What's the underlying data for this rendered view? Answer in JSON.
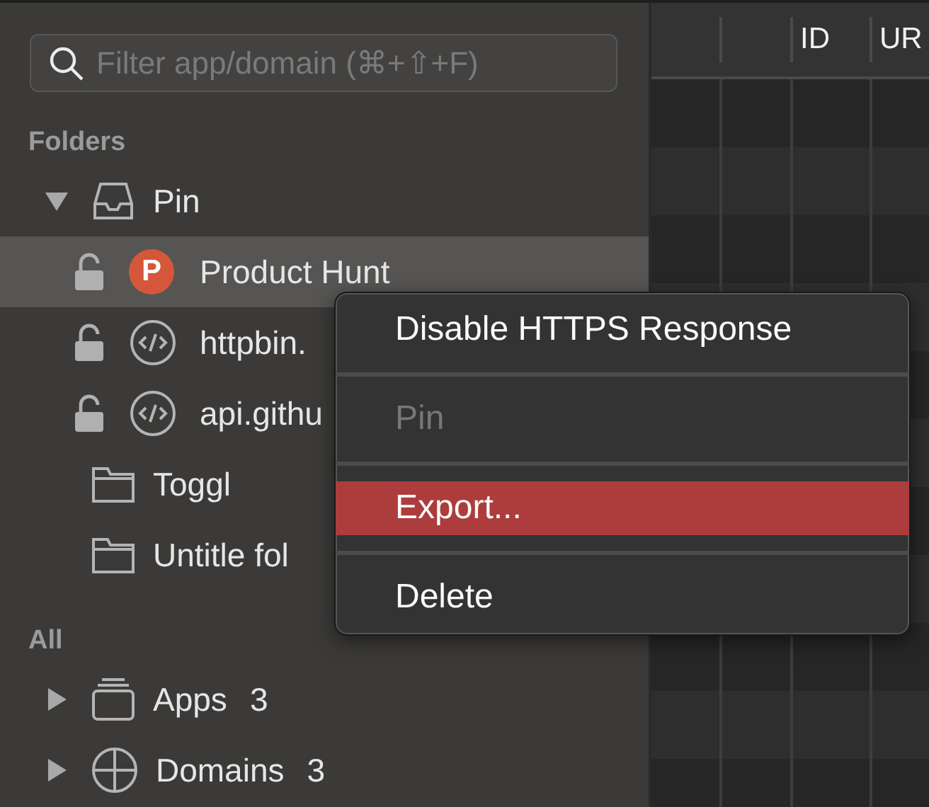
{
  "search": {
    "placeholder": "Filter app/domain (⌘+⇧+F)"
  },
  "sections": [
    {
      "title": "Folders",
      "items": [
        {
          "label": "Pin",
          "kind": "inbox",
          "expanded": true,
          "selected": false,
          "children": [
            {
              "label": "Product Hunt",
              "kind": "logo",
              "badge": "P",
              "selected": true
            },
            {
              "label": "httpbin.",
              "kind": "code",
              "selected": false
            },
            {
              "label": "api.githu",
              "kind": "code",
              "selected": false
            }
          ]
        },
        {
          "label": "Toggl",
          "kind": "folder",
          "selected": false
        },
        {
          "label": "Untitle fol",
          "kind": "folder",
          "selected": false
        }
      ]
    },
    {
      "title": "All",
      "items": [
        {
          "label": "Apps",
          "count": "3",
          "kind": "stack",
          "expanded": false,
          "selected": false
        },
        {
          "label": "Domains",
          "count": "3",
          "kind": "globe",
          "expanded": false,
          "selected": false
        }
      ]
    }
  ],
  "table": {
    "columns": [
      "",
      "",
      "ID",
      "UR"
    ]
  },
  "context_menu": {
    "items": [
      {
        "label": "Disable HTTPS Response",
        "disabled": false,
        "selected": false
      },
      {
        "label": "Pin",
        "disabled": true,
        "selected": false
      },
      {
        "label": "Export...",
        "disabled": false,
        "selected": true
      },
      {
        "label": "Delete",
        "disabled": false,
        "selected": false
      }
    ]
  }
}
